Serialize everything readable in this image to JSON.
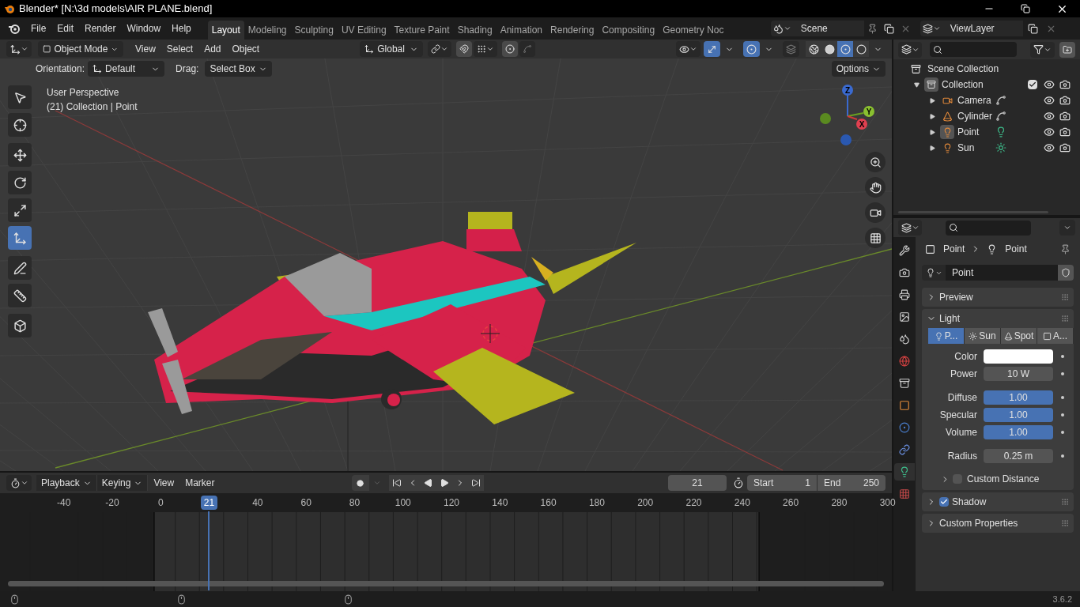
{
  "window": {
    "title": "Blender* [N:\\3d models\\AIR PLANE.blend]"
  },
  "menu": [
    "File",
    "Edit",
    "Render",
    "Window",
    "Help"
  ],
  "workspaces": [
    {
      "label": "Layout",
      "selected": true
    },
    {
      "label": "Modeling",
      "selected": false
    },
    {
      "label": "Sculpting",
      "selected": false
    },
    {
      "label": "UV Editing",
      "selected": false
    },
    {
      "label": "Texture Paint",
      "selected": false
    },
    {
      "label": "Shading",
      "selected": false
    },
    {
      "label": "Animation",
      "selected": false
    },
    {
      "label": "Rendering",
      "selected": false
    },
    {
      "label": "Compositing",
      "selected": false
    },
    {
      "label": "Geometry Noc",
      "selected": false
    }
  ],
  "scene": "Scene",
  "view_layer": "ViewLayer",
  "viewport": {
    "mode": "Object Mode",
    "menus": [
      "View",
      "Select",
      "Add",
      "Object"
    ],
    "transform": "Global",
    "orientation_label": "Orientation:",
    "orientation": "Default",
    "drag_label": "Drag:",
    "drag": "Select Box",
    "options": "Options",
    "perspective": "User Perspective",
    "info": "(21) Collection | Point",
    "axes": [
      "X",
      "Y",
      "Z"
    ],
    "tool_groups": [
      [
        {
          "kind": "select",
          "selected": false
        },
        {
          "kind": "cursor",
          "selected": false
        }
      ],
      [
        {
          "kind": "move",
          "selected": false
        },
        {
          "kind": "rotate",
          "selected": false
        },
        {
          "kind": "scale",
          "selected": false
        },
        {
          "kind": "transform",
          "selected": true
        }
      ],
      [
        {
          "kind": "annotate",
          "selected": false
        },
        {
          "kind": "measure",
          "selected": false
        }
      ],
      [
        {
          "kind": "add-cube",
          "selected": false
        }
      ]
    ],
    "shading": [
      {
        "kind": "wireframe",
        "selected": false
      },
      {
        "kind": "solid",
        "selected": false
      },
      {
        "kind": "material",
        "selected": true
      },
      {
        "kind": "rendered",
        "selected": false
      }
    ]
  },
  "outliner": {
    "root": "Scene Collection",
    "collection": {
      "name": "Collection",
      "checked": true,
      "children": [
        {
          "name": "Camera",
          "kind": "camera",
          "selected": false
        },
        {
          "name": "Cylinder",
          "kind": "mesh",
          "selected": false
        },
        {
          "name": "Point",
          "kind": "point-light",
          "selected": true
        },
        {
          "name": "Sun",
          "kind": "sun-light",
          "selected": false
        }
      ]
    }
  },
  "properties": {
    "tabs": [
      {
        "kind": "tool",
        "selected": false
      },
      {
        "kind": "render",
        "selected": false
      },
      {
        "kind": "output",
        "selected": false
      },
      {
        "kind": "view-layer",
        "selected": false
      },
      {
        "kind": "scene",
        "selected": false
      },
      {
        "kind": "world",
        "selected": false
      },
      {
        "kind": "collection",
        "selected": false
      },
      {
        "kind": "object",
        "selected": false
      },
      {
        "kind": "physics",
        "selected": false
      },
      {
        "kind": "constraints",
        "selected": false
      },
      {
        "kind": "light",
        "selected": true
      },
      {
        "kind": "texture",
        "selected": false
      }
    ],
    "breadcrumb": [
      "Point",
      "Point"
    ],
    "datablock": "Point",
    "panels": [
      {
        "title": "Preview",
        "kind": "plain",
        "expanded": false
      },
      {
        "title": "Light",
        "kind": "light",
        "expanded": true
      },
      {
        "title": "Shadow",
        "kind": "checkbox",
        "checked": true,
        "expanded": false
      },
      {
        "title": "Custom Properties",
        "kind": "plain",
        "expanded": false
      }
    ],
    "light": {
      "types": [
        {
          "label": "P...",
          "kind": "point",
          "selected": true
        },
        {
          "label": "Sun",
          "kind": "sun",
          "selected": false
        },
        {
          "label": "Spot",
          "kind": "spot",
          "selected": false
        },
        {
          "label": "A...",
          "kind": "area",
          "selected": false
        }
      ],
      "groups": [
        [
          {
            "label": "Color",
            "kind": "color",
            "color": "#ffffff"
          },
          {
            "label": "Power",
            "kind": "number",
            "value": "10 W"
          }
        ],
        [
          {
            "label": "Diffuse",
            "kind": "factor",
            "value": "1.00",
            "level": 1
          },
          {
            "label": "Specular",
            "kind": "factor",
            "value": "1.00",
            "level": 1
          },
          {
            "label": "Volume",
            "kind": "factor",
            "value": "1.00",
            "level": 1
          }
        ],
        [
          {
            "label": "Radius",
            "kind": "number",
            "value": "0.25 m"
          }
        ]
      ],
      "custom_distance": {
        "label": "Custom Distance",
        "checked": false
      }
    }
  },
  "timeline": {
    "menus": [
      {
        "label": "Playback",
        "dropdown": true
      },
      {
        "label": "Keying",
        "dropdown": true
      },
      {
        "label": "View",
        "dropdown": false
      },
      {
        "label": "Marker",
        "dropdown": false
      }
    ],
    "current_frame": "21",
    "start_label": "Start",
    "start": "1",
    "end_label": "End",
    "end": "250",
    "ruler": [
      {
        "label": "-40",
        "kind": "tick"
      },
      {
        "label": "-20",
        "kind": "tick"
      },
      {
        "label": "0",
        "kind": "tick"
      },
      {
        "label": "21",
        "kind": "playhead"
      },
      {
        "label": "40",
        "kind": "tick"
      },
      {
        "label": "60",
        "kind": "tick"
      },
      {
        "label": "80",
        "kind": "tick"
      },
      {
        "label": "100",
        "kind": "tick"
      },
      {
        "label": "120",
        "kind": "tick"
      },
      {
        "label": "140",
        "kind": "tick"
      },
      {
        "label": "160",
        "kind": "tick"
      },
      {
        "label": "180",
        "kind": "tick"
      },
      {
        "label": "200",
        "kind": "tick"
      },
      {
        "label": "220",
        "kind": "tick"
      },
      {
        "label": "240",
        "kind": "tick"
      },
      {
        "label": "260",
        "kind": "tick"
      },
      {
        "label": "280",
        "kind": "tick"
      },
      {
        "label": "300",
        "kind": "tick"
      }
    ]
  },
  "status": {
    "version": "3.6.2"
  }
}
